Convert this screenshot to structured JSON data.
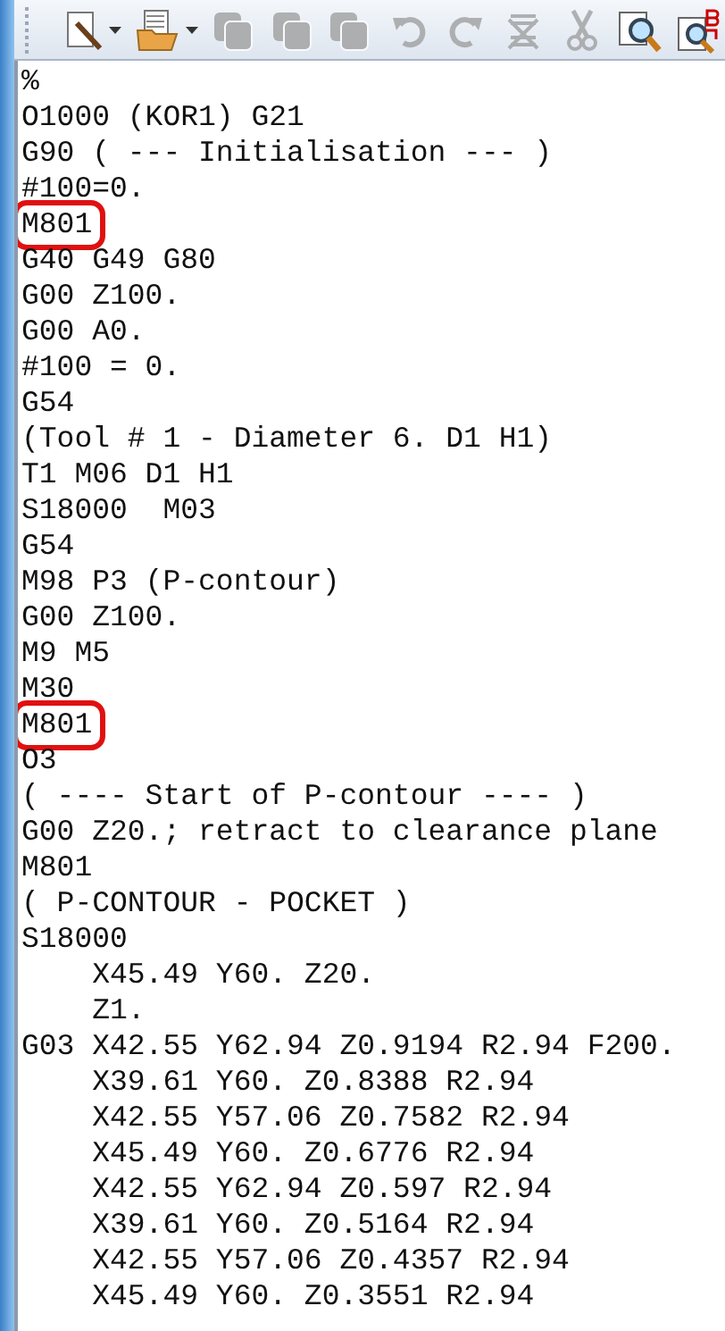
{
  "toolbar": [
    {
      "kind": "new",
      "disabled": false,
      "dropdown": true
    },
    {
      "kind": "open",
      "disabled": false,
      "dropdown": true
    },
    {
      "kind": "copy",
      "disabled": true,
      "dropdown": false
    },
    {
      "kind": "copy",
      "disabled": true,
      "dropdown": false
    },
    {
      "kind": "copy",
      "disabled": true,
      "dropdown": false
    },
    {
      "kind": "undo",
      "disabled": true,
      "dropdown": false
    },
    {
      "kind": "redo",
      "disabled": true,
      "dropdown": false
    },
    {
      "kind": "strike",
      "disabled": true,
      "dropdown": false
    },
    {
      "kind": "cut",
      "disabled": true,
      "dropdown": false
    },
    {
      "kind": "find",
      "disabled": false,
      "dropdown": false
    },
    {
      "kind": "replace",
      "disabled": false,
      "dropdown": false
    }
  ],
  "lines": [
    {
      "text": "%",
      "marked": false
    },
    {
      "text": "O1000 (KOR1) G21",
      "marked": false
    },
    {
      "text": "G90 ( --- Initialisation --- )",
      "marked": false
    },
    {
      "text": "#100=0.",
      "marked": false
    },
    {
      "text": "M801",
      "marked": true
    },
    {
      "text": "G40 G49 G80",
      "marked": false
    },
    {
      "text": "G00 Z100.",
      "marked": false
    },
    {
      "text": "G00 A0.",
      "marked": false
    },
    {
      "text": "#100 = 0.",
      "marked": false
    },
    {
      "text": "G54",
      "marked": false
    },
    {
      "text": "(Tool # 1 - Diameter 6. D1 H1)",
      "marked": false
    },
    {
      "text": "T1 M06 D1 H1",
      "marked": false
    },
    {
      "text": "S18000  M03",
      "marked": false
    },
    {
      "text": "G54",
      "marked": false
    },
    {
      "text": "M98 P3 (P-contour)",
      "marked": false
    },
    {
      "text": "G00 Z100.",
      "marked": false
    },
    {
      "text": "M9 M5",
      "marked": false
    },
    {
      "text": "M30",
      "marked": false
    },
    {
      "text": "M801",
      "marked": true
    },
    {
      "text": "O3",
      "marked": false
    },
    {
      "text": "( ---- Start of P-contour ---- )",
      "marked": false
    },
    {
      "text": "G00 Z20.; retract to clearance plane",
      "marked": false
    },
    {
      "text": "M801",
      "marked": false
    },
    {
      "text": "( P-CONTOUR - POCKET )",
      "marked": false
    },
    {
      "text": "S18000",
      "marked": false
    },
    {
      "text": "    X45.49 Y60. Z20.",
      "marked": false
    },
    {
      "text": "    Z1.",
      "marked": false
    },
    {
      "text": "G03 X42.55 Y62.94 Z0.9194 R2.94 F200.",
      "marked": false
    },
    {
      "text": "    X39.61 Y60. Z0.8388 R2.94",
      "marked": false
    },
    {
      "text": "    X42.55 Y57.06 Z0.7582 R2.94",
      "marked": false
    },
    {
      "text": "    X45.49 Y60. Z0.6776 R2.94",
      "marked": false
    },
    {
      "text": "    X42.55 Y62.94 Z0.597 R2.94",
      "marked": false
    },
    {
      "text": "    X39.61 Y60. Z0.5164 R2.94",
      "marked": false
    },
    {
      "text": "    X42.55 Y57.06 Z0.4357 R2.94",
      "marked": false
    },
    {
      "text": "    X45.49 Y60. Z0.3551 R2.94",
      "marked": false
    }
  ]
}
